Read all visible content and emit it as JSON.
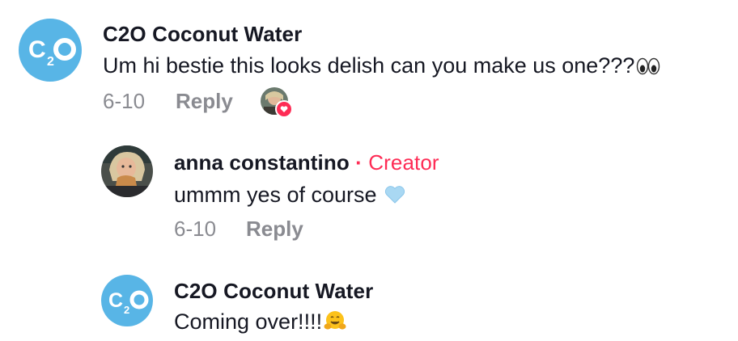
{
  "comments": [
    {
      "author": "C2O Coconut Water",
      "text": "Um hi bestie this looks delish can you make us one???",
      "text_emoji": "eyes-emoji",
      "date": "6-10",
      "reply_label": "Reply",
      "liked_by_creator": true
    },
    {
      "author": "anna constantino",
      "author_separator": "·",
      "author_tag": "Creator",
      "text": "ummm yes of course",
      "text_emoji": "light-blue-heart-emoji",
      "date": "6-10",
      "reply_label": "Reply"
    },
    {
      "author": "C2O Coconut Water",
      "text": "Coming over!!!!",
      "text_emoji": "hugging-face-emoji"
    }
  ],
  "colors": {
    "brand_avatar": "#58b5e6",
    "creator_accent": "#fe2c55",
    "meta_gray": "#8a8b91",
    "text": "#161823"
  }
}
